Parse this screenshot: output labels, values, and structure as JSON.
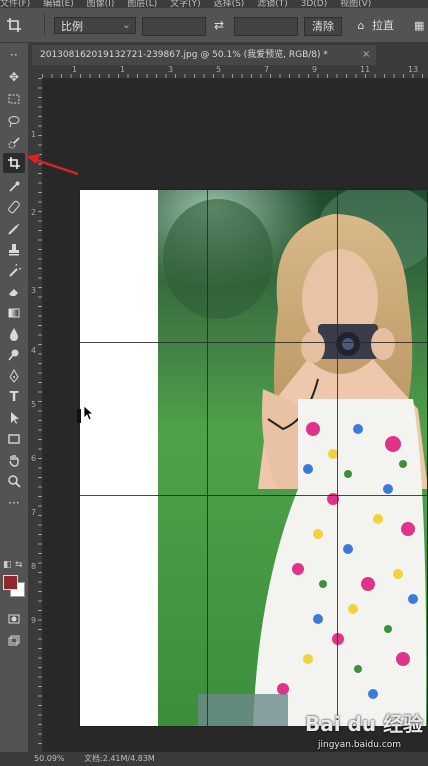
{
  "menu": {
    "items": [
      "文件(F)",
      "编辑(E)",
      "图像(I)",
      "图层(L)",
      "文字(Y)",
      "选择(S)",
      "滤镜(T)",
      "3D(D)",
      "视图(V)"
    ]
  },
  "options": {
    "ratio_value": "比例",
    "width_value": "",
    "height_value": "",
    "clear_label": "清除",
    "straighten_label": "拉直"
  },
  "document": {
    "tab_title": "2013081620191327​21-239867.jpg @ 50.1% (我爱预览, RGB/8) *"
  },
  "rulers": {
    "horizontal": [
      "1",
      "1",
      "3",
      "5",
      "7",
      "9",
      "11",
      "13"
    ],
    "vertical": [
      "1",
      "2",
      "3",
      "4",
      "5",
      "6",
      "7",
      "8",
      "9"
    ]
  },
  "status": {
    "zoom": "50.09%",
    "doc_size": "文档:2.41M/4.83M"
  },
  "colors": {
    "foreground": "#8e2a2e",
    "background": "#ffffff",
    "annotation": "#e02020"
  },
  "watermark": {
    "brand": "Bai du 经验",
    "url": "jingyan.baidu.com"
  }
}
